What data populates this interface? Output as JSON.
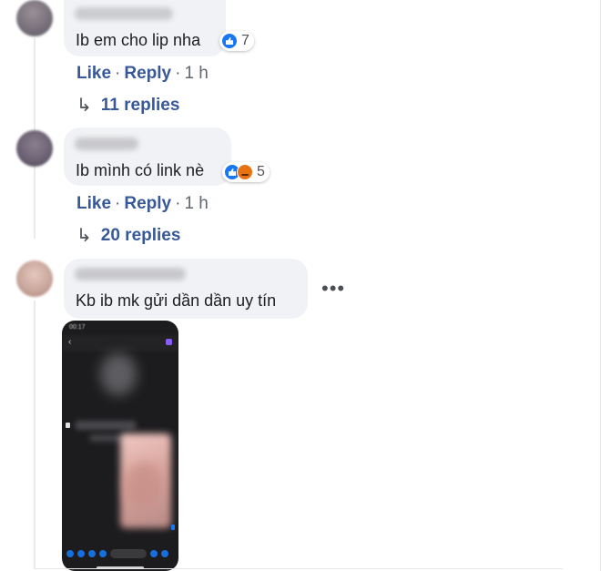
{
  "comments": [
    {
      "text": "Ib em cho lip nha",
      "reaction_count": "7",
      "reactions": [
        "like-icon"
      ],
      "actions": {
        "like": "Like",
        "reply": "Reply",
        "time": "1 h"
      },
      "replies_label": "11 replies"
    },
    {
      "text": "Ib mình có link nè",
      "reaction_count": "5",
      "reactions": [
        "like-icon",
        "angry-icon"
      ],
      "actions": {
        "like": "Like",
        "reply": "Reply",
        "time": "1 h"
      },
      "replies_label": "20 replies"
    },
    {
      "text": "Kb ib mk gửi dần dần uy tín",
      "more_label": "•••",
      "attachment": {
        "type": "phone-screenshot",
        "status_time": "00:17"
      }
    }
  ],
  "glyphs": {
    "separator": "·",
    "reply_arrow": "↳",
    "back": "‹"
  },
  "colors": {
    "link": "#385898",
    "bubble": "#f0f2f5",
    "like": "#1877f2",
    "angry": "#e9710f"
  }
}
